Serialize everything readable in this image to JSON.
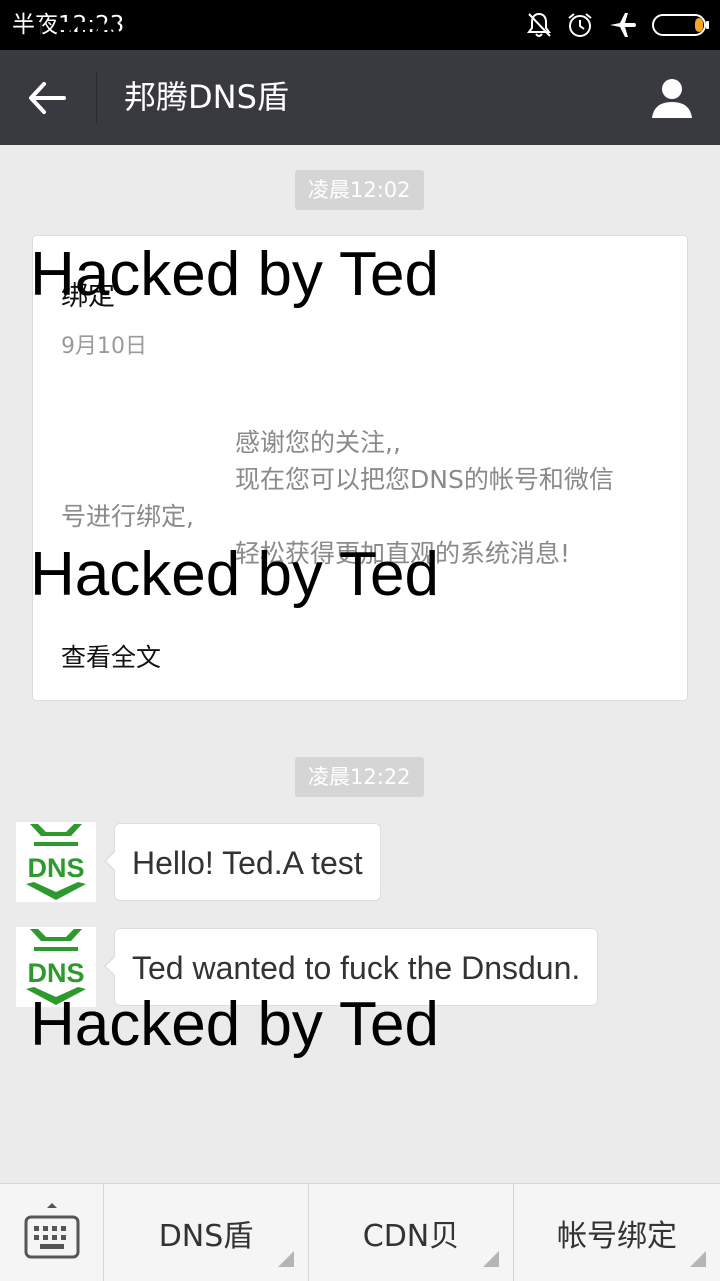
{
  "status_bar": {
    "time": "半夜12:23"
  },
  "header": {
    "title": "邦腾DNS盾"
  },
  "chat": {
    "timestamps": [
      "凌晨12:02",
      "凌晨12:22"
    ],
    "article": {
      "title": "绑定",
      "date": "9月10日",
      "body_lines": [
        "感谢您的关注,,",
        "现在您可以把您DNS的帐号和微信",
        "号进行绑定,",
        "轻松获得更加直观的系统消息!"
      ],
      "read_more": "查看全文"
    },
    "messages": [
      {
        "text": "Hello! Ted.A test",
        "avatar_text": "DNS"
      },
      {
        "text": "Ted wanted to fuck the Dnsdun.",
        "avatar_text": "DNS"
      }
    ]
  },
  "overlay": {
    "text": "Hacked by Ted"
  },
  "bottom_menu": {
    "items": [
      "DNS盾",
      "CDN贝",
      "帐号绑定"
    ]
  },
  "colors": {
    "header": "#393a3f",
    "background": "#ebebeb",
    "logo_green": "#2e9a2e"
  }
}
